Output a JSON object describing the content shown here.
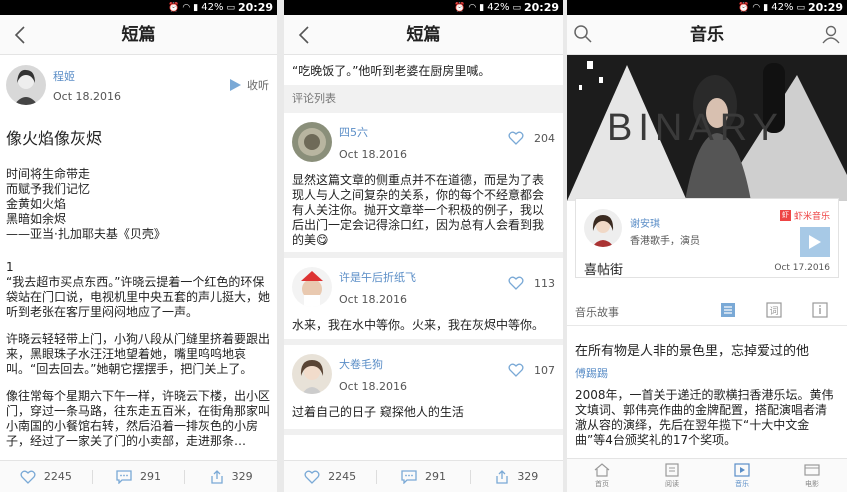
{
  "status": {
    "battery": "42%",
    "time": "20:29"
  },
  "panel1": {
    "title": "短篇",
    "author": {
      "name": "程姬",
      "date": "Oct 18.2016"
    },
    "collect_label": "收听",
    "article_title": "像火焰像灰烬",
    "poem": [
      "时间将生命带走",
      "而赋予我们记忆",
      "金黄如火焰",
      "黑暗如余烬",
      "——亚当·扎加耶夫基《贝壳》"
    ],
    "section_number": "1",
    "paragraphs": [
      "“我去超市买点东西。”许晓云提着一个红色的环保袋站在门口说，电视机里中央五套的声儿挺大，她听到老张在客厅里闷闷地应了一声。",
      "许晓云轻轻带上门，小狗八段从门缝里挤着要跟出来，黑眼珠子水汪汪地望着她，嘴里呜呜地哀叫。“回去回去。”她朝它摆摆手，把门关上了。",
      "像往常每个星期六下午一样，许晓云下楼，出小区门，穿过一条马路，往东走五百米，在街角那家叫小南国的小餐馆右转，然后沿着一排灰色的小房子，经过了一家关了门的小卖部，走进那条…"
    ],
    "footer": {
      "likes": "2245",
      "comments": "291",
      "shares": "329"
    }
  },
  "panel2": {
    "title": "短篇",
    "top_line": "“吃晚饭了。”他听到老婆在厨房里喊。",
    "section_label": "评论列表",
    "comments": [
      {
        "name": "四5六",
        "date": "Oct 18.2016",
        "likes": "204",
        "text": "显然这篇文章的侧重点并不在道德，而是为了表现人与人之间复杂的关系，你的每个不经意都会有人关注你。抛开文章举一个积极的例子，我以后出门一定会记得涂口红，因为总有人会看到我的美😋"
      },
      {
        "name": "许是午后折纸飞",
        "date": "Oct 18.2016",
        "likes": "113",
        "text": "水来，我在水中等你。火来，我在灰烬中等你。"
      },
      {
        "name": "大卷毛狗",
        "date": "Oct 18.2016",
        "likes": "107",
        "text": "过着自己的日子 窥探他人的生活"
      }
    ],
    "footer": {
      "likes": "2245",
      "comments": "291",
      "shares": "329"
    }
  },
  "panel3": {
    "title": "音乐",
    "cover_text": "BINARY",
    "singer": {
      "name": "谢安琪",
      "desc": "香港歌手，演员"
    },
    "badge": "虾米音乐",
    "song": "喜帖街",
    "song_date": "Oct 17.2016",
    "story_label": "音乐故事",
    "music_title": "在所有物是人非的景色里，忘掉爱过的他",
    "music_author": "傅踢踢",
    "music_body": "2008年，一首关于递迁的歌横扫香港乐坛。黄伟文填词、郭伟亮作曲的金牌配置，搭配演唱者清澈从容的演绎，先后在翌年揽下“十大中文金曲”等4台颁奖礼的17个奖项。",
    "tabs": [
      "首页",
      "阅读",
      "音乐",
      "电影"
    ]
  },
  "colors": {
    "link": "#5b8ec7",
    "accent": "#a7c9e6"
  }
}
